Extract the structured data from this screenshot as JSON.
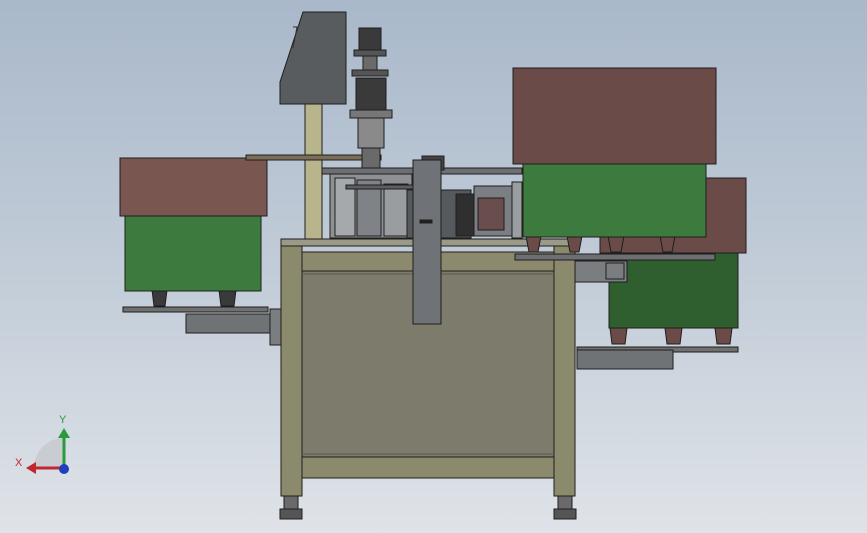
{
  "viewport": {
    "background_top": "#a9b8ca",
    "background_bottom": "#dfe3e8"
  },
  "colors": {
    "frame_olive": "#8c8a6c",
    "panel_gray": "#7d7c6c",
    "brown_bin": "#6b4b48",
    "brown_bin_light": "#7a5651",
    "green_bin": "#3d7a3d",
    "dark_green": "#2f5f2f",
    "cabinet_gray": "#595c5f",
    "mast_tan": "#b8b48c",
    "outline": "#1e1e1e"
  },
  "triad": {
    "x_label": "X",
    "y_label": "Y",
    "x_color": "#c0282d",
    "y_color": "#2a9a3a",
    "z_color": "#1f3fbf"
  }
}
